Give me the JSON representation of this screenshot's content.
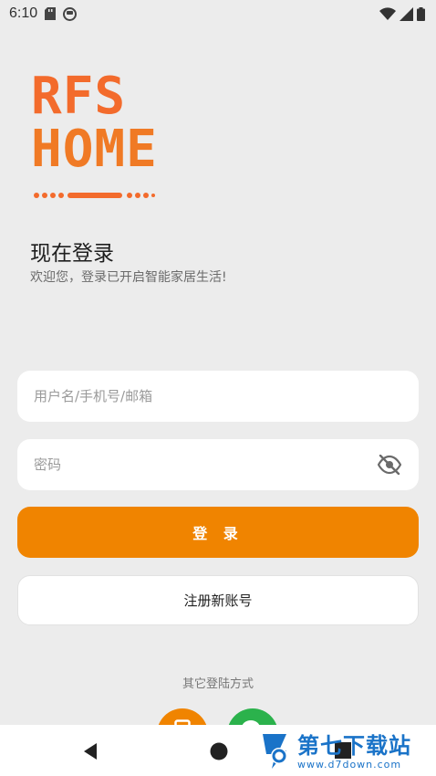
{
  "status_bar": {
    "time": "6:10"
  },
  "logo": {
    "line1": "RFS",
    "line2": "HOME"
  },
  "header": {
    "title": "现在登录",
    "subtitle": "欢迎您，登录已开启智能家居生活!"
  },
  "form": {
    "username_placeholder": "用户名/手机号/邮箱",
    "password_placeholder": "密码",
    "login_label": "登 录",
    "register_label": "注册新账号"
  },
  "other_login": {
    "label": "其它登陆方式"
  },
  "watermark": {
    "cn": "第七下载站",
    "url": "www.d7down.com"
  },
  "colors": {
    "accent": "#f08400",
    "logo": "#f36b2c",
    "background": "#ececec",
    "wechat": "#2bb24c"
  }
}
